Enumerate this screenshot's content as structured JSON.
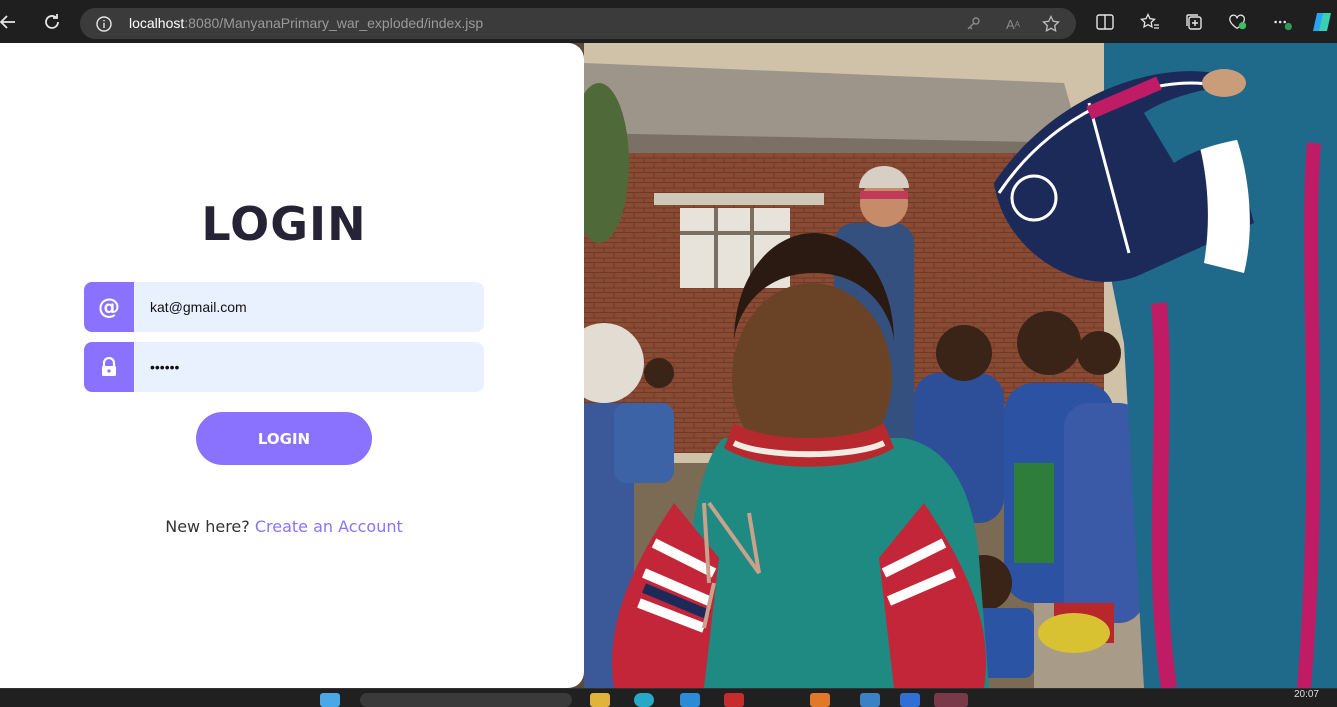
{
  "browser": {
    "url_host": "localhost",
    "url_rest": ":8080/ManyanaPrimary_war_exploded/index.jsp"
  },
  "icons": {
    "back": "back-arrow-icon",
    "refresh": "refresh-icon",
    "info": "info-icon",
    "email": "at-sign-icon",
    "password": "lock-icon"
  },
  "login": {
    "title": "LOGIN",
    "email_value": "kat@gmail.com",
    "password_value": "••••••",
    "button_label": "LOGIN",
    "signup_prefix": "New here?",
    "signup_link": "Create an Account"
  },
  "colors": {
    "accent": "#8a72ff",
    "input_bg": "#e9f0fe",
    "title": "#262336"
  },
  "taskbar": {
    "clock": "20:07"
  }
}
